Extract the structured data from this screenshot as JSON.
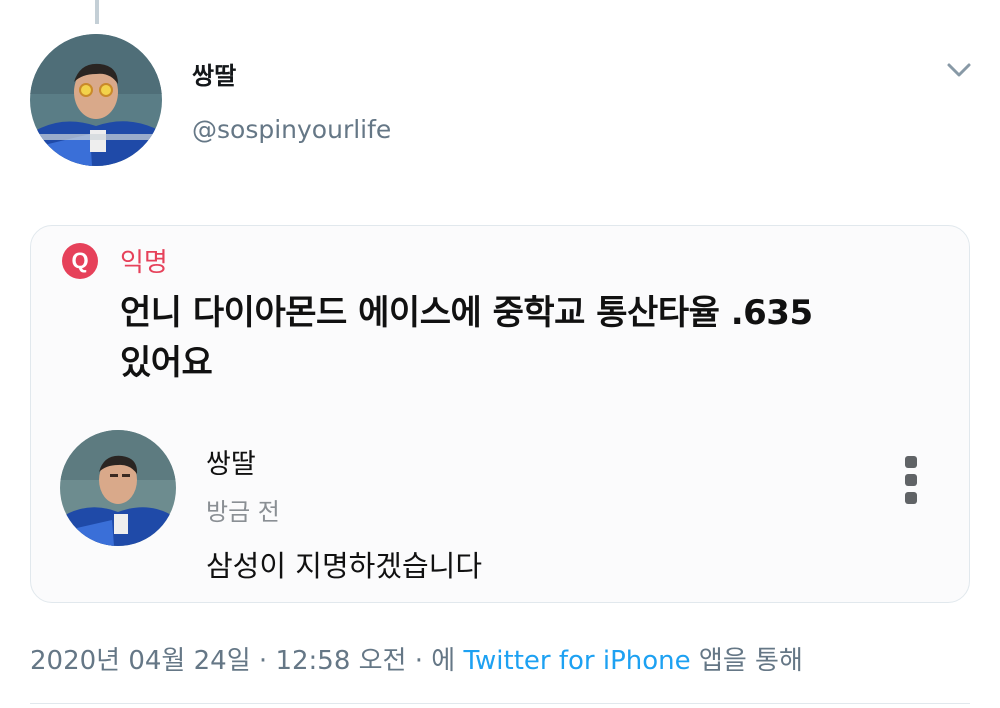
{
  "tweet": {
    "author": {
      "display_name": "쌍딸",
      "handle": "@sospinyourlife"
    },
    "card": {
      "badge": "Q",
      "label": "익명",
      "question_line1": "언니 다이아몬드 에이스에 중학교 통산타율 .635",
      "question_line2": "있어요",
      "reply": {
        "name": "쌍딸",
        "time": "방금 전",
        "text": "삼성이 지명하겠습니다"
      }
    },
    "meta": {
      "date": "2020년 04월 24일",
      "separator1": " · ",
      "time": "12:58 오전",
      "separator2": " · 에 ",
      "source": "Twitter for iPhone",
      "suffix": " 앱을 통해"
    }
  },
  "colors": {
    "accent_pink": "#e6415a",
    "link_blue": "#1da1f2",
    "muted_gray": "#657786"
  },
  "icons": {
    "avatar": "profile-photo",
    "menu": "chevron-down-icon",
    "more": "vertical-more-icon"
  }
}
